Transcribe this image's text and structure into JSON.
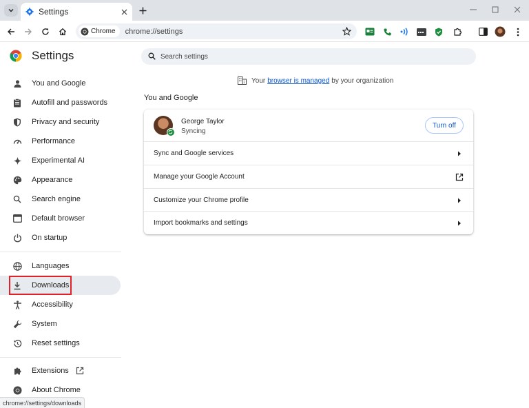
{
  "tab": {
    "title": "Settings"
  },
  "toolbar": {
    "site_chip": "Chrome",
    "url": "chrome://settings"
  },
  "sidebar": {
    "brand": "Settings",
    "items": [
      {
        "label": "You and Google",
        "icon": "person-icon"
      },
      {
        "label": "Autofill and passwords",
        "icon": "clipboard-icon"
      },
      {
        "label": "Privacy and security",
        "icon": "shield-icon"
      },
      {
        "label": "Performance",
        "icon": "speedometer-icon"
      },
      {
        "label": "Experimental AI",
        "icon": "sparkle-icon"
      },
      {
        "label": "Appearance",
        "icon": "palette-icon"
      },
      {
        "label": "Search engine",
        "icon": "search-icon"
      },
      {
        "label": "Default browser",
        "icon": "browser-icon"
      },
      {
        "label": "On startup",
        "icon": "power-icon"
      },
      {
        "label": "Languages",
        "icon": "globe-icon"
      },
      {
        "label": "Downloads",
        "icon": "download-icon"
      },
      {
        "label": "Accessibility",
        "icon": "accessibility-icon"
      },
      {
        "label": "System",
        "icon": "wrench-icon"
      },
      {
        "label": "Reset settings",
        "icon": "history-icon"
      },
      {
        "label": "Extensions",
        "icon": "puzzle-icon"
      },
      {
        "label": "About Chrome",
        "icon": "chrome-logo-icon"
      }
    ],
    "active_item": "Downloads"
  },
  "main": {
    "search_placeholder": "Search settings",
    "managed": {
      "before": "Your",
      "link": "browser is managed",
      "after": "by your organization"
    },
    "section_title": "You and Google",
    "profile": {
      "name": "George Taylor",
      "status": "Syncing",
      "button": "Turn off"
    },
    "rows": [
      {
        "label": "Sync and Google services"
      },
      {
        "label": "Manage your Google Account"
      },
      {
        "label": "Customize your Chrome profile"
      },
      {
        "label": "Import bookmarks and settings"
      }
    ]
  },
  "statusbar": {
    "url": "chrome://settings/downloads"
  },
  "colors": {
    "accent": "#0b57d0",
    "highlight": "#e02128",
    "sync": "#1e8e3e"
  }
}
